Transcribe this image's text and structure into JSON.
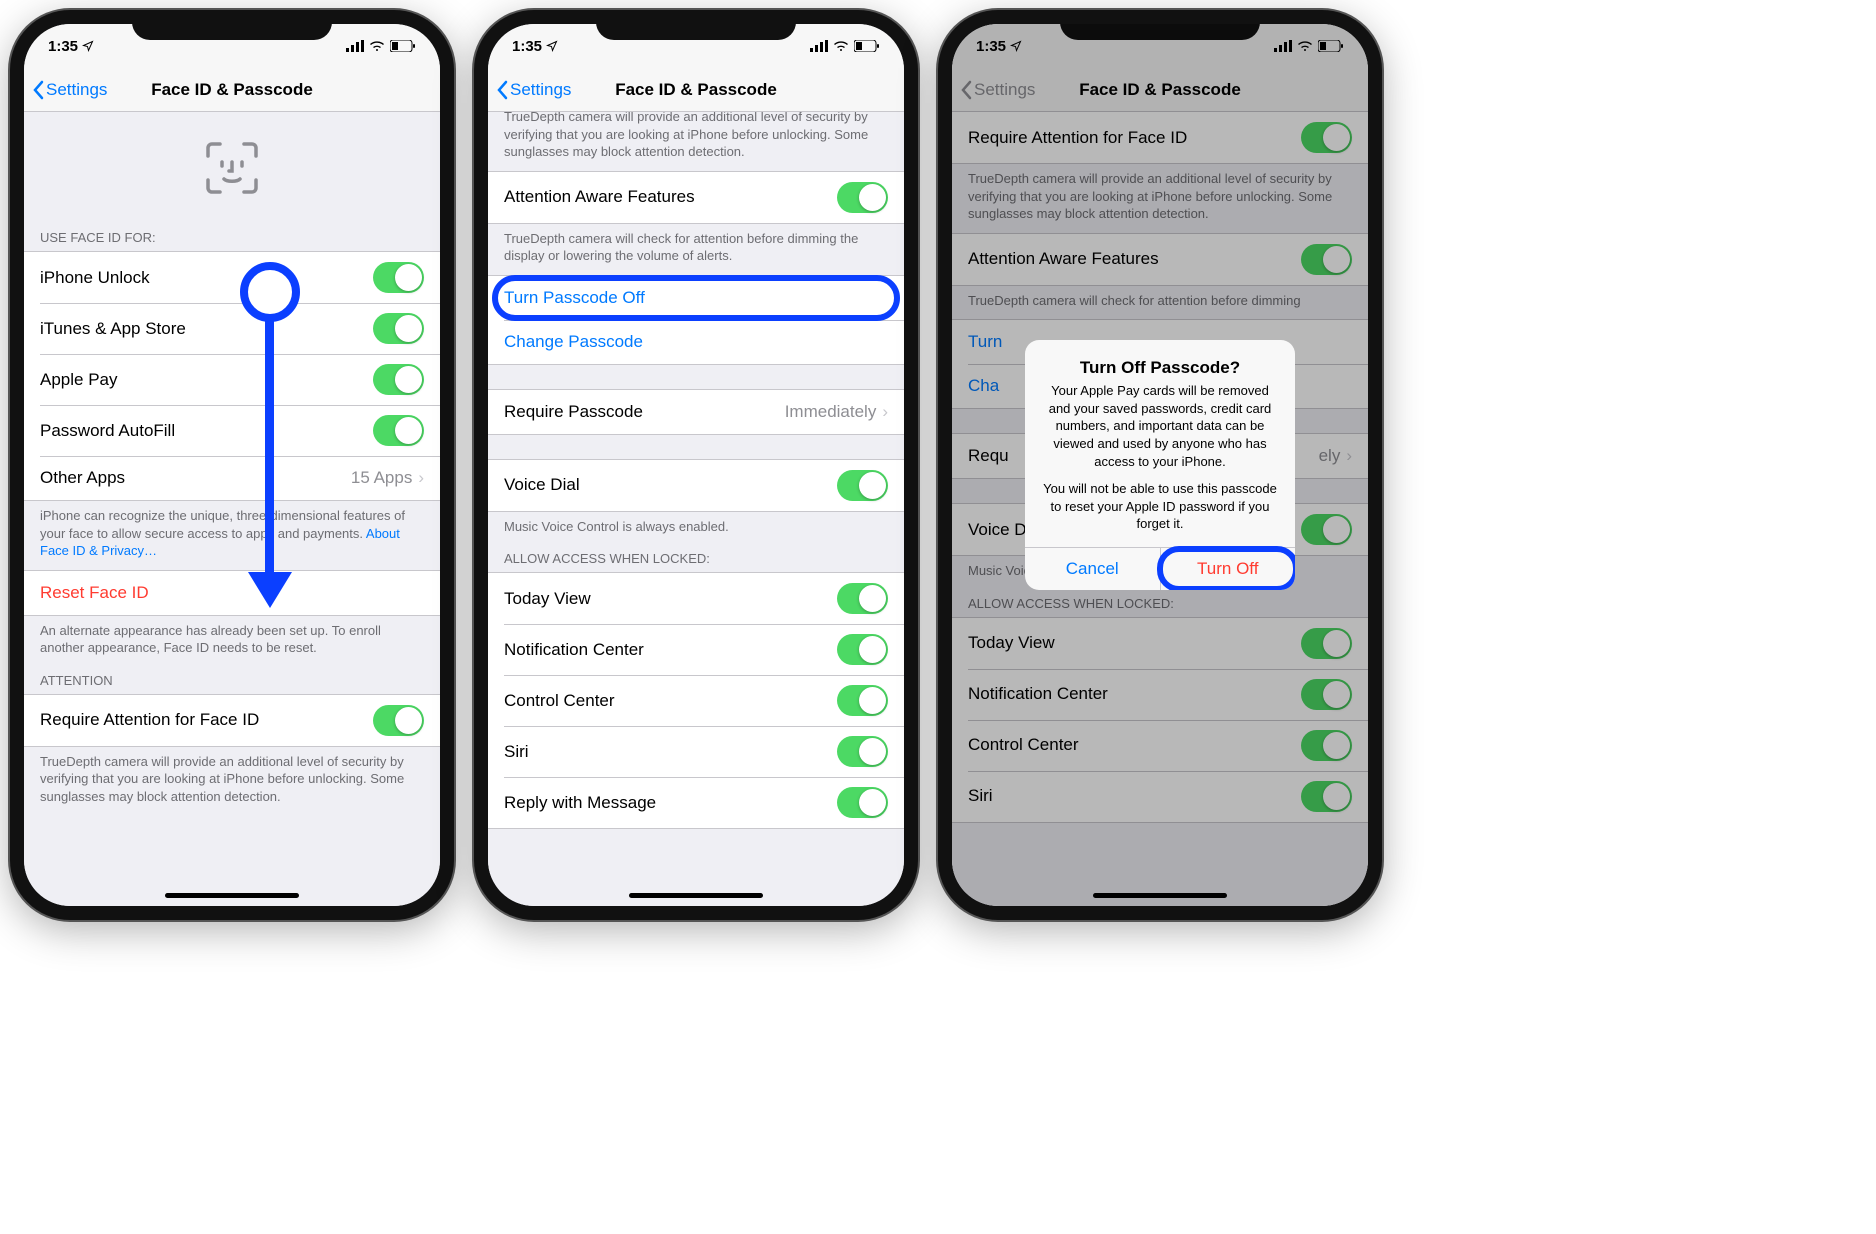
{
  "status": {
    "time": "1:35",
    "loc_arrow": "➤"
  },
  "nav": {
    "back": "Settings",
    "title": "Face ID & Passcode"
  },
  "screen1": {
    "section_use_for_header": "USE FACE ID FOR:",
    "items_use_for": [
      {
        "label": "iPhone Unlock"
      },
      {
        "label": "iTunes & App Store"
      },
      {
        "label": "Apple Pay"
      },
      {
        "label": "Password AutoFill"
      }
    ],
    "other_apps": {
      "label": "Other Apps",
      "value": "15 Apps"
    },
    "use_for_footer": "iPhone can recognize the unique, three-dimensional features of your face to allow secure access to apps and payments. ",
    "use_for_footer_link": "About Face ID & Privacy…",
    "reset_face_id": "Reset Face ID",
    "reset_footer": "An alternate appearance has already been set up. To enroll another appearance, Face ID needs to be reset.",
    "attention_header": "ATTENTION",
    "require_attention": "Require Attention for Face ID",
    "require_attention_footer": "TrueDepth camera will provide an additional level of security by verifying that you are looking at iPhone before unlocking. Some sunglasses may block attention detection."
  },
  "screen2": {
    "top_footer_partial": "TrueDepth camera will provide an additional level of security by verifying that you are looking at iPhone before unlocking. Some sunglasses may block attention detection.",
    "attention_aware": "Attention Aware Features",
    "attention_aware_footer": "TrueDepth camera will check for attention before dimming the display or lowering the volume of alerts.",
    "turn_off": "Turn Passcode Off",
    "change": "Change Passcode",
    "require_passcode": {
      "label": "Require Passcode",
      "value": "Immediately"
    },
    "voice_dial": "Voice Dial",
    "voice_dial_footer": "Music Voice Control is always enabled.",
    "allow_header": "ALLOW ACCESS WHEN LOCKED:",
    "allow_items": [
      {
        "label": "Today View"
      },
      {
        "label": "Notification Center"
      },
      {
        "label": "Control Center"
      },
      {
        "label": "Siri"
      },
      {
        "label": "Reply with Message"
      }
    ]
  },
  "screen3": {
    "require_attention": "Require Attention for Face ID",
    "require_attention_footer": "TrueDepth camera will provide an additional level of security by verifying that you are looking at iPhone before unlocking. Some sunglasses may block attention detection.",
    "attention_aware": "Attention Aware Features",
    "attention_aware_footer": "TrueDepth camera will check for attention before dimming",
    "turn_off_partial": "Turn",
    "change_partial": "Cha",
    "require_passcode": {
      "label": "Requ",
      "value": "ely"
    },
    "voice_dial": "Voice Dial",
    "voice_dial_footer": "Music Voice Control is always enabled.",
    "allow_header": "ALLOW ACCESS WHEN LOCKED:",
    "allow_items": [
      {
        "label": "Today View"
      },
      {
        "label": "Notification Center"
      },
      {
        "label": "Control Center"
      },
      {
        "label": "Siri"
      }
    ],
    "alert": {
      "title": "Turn Off Passcode?",
      "p1": "Your Apple Pay cards will be removed and your saved passwords, credit card numbers, and important data can be viewed and used by anyone who has access to your iPhone.",
      "p2": "You will not be able to use this passcode to reset your Apple ID password if you forget it.",
      "cancel": "Cancel",
      "turn_off": "Turn Off"
    }
  }
}
